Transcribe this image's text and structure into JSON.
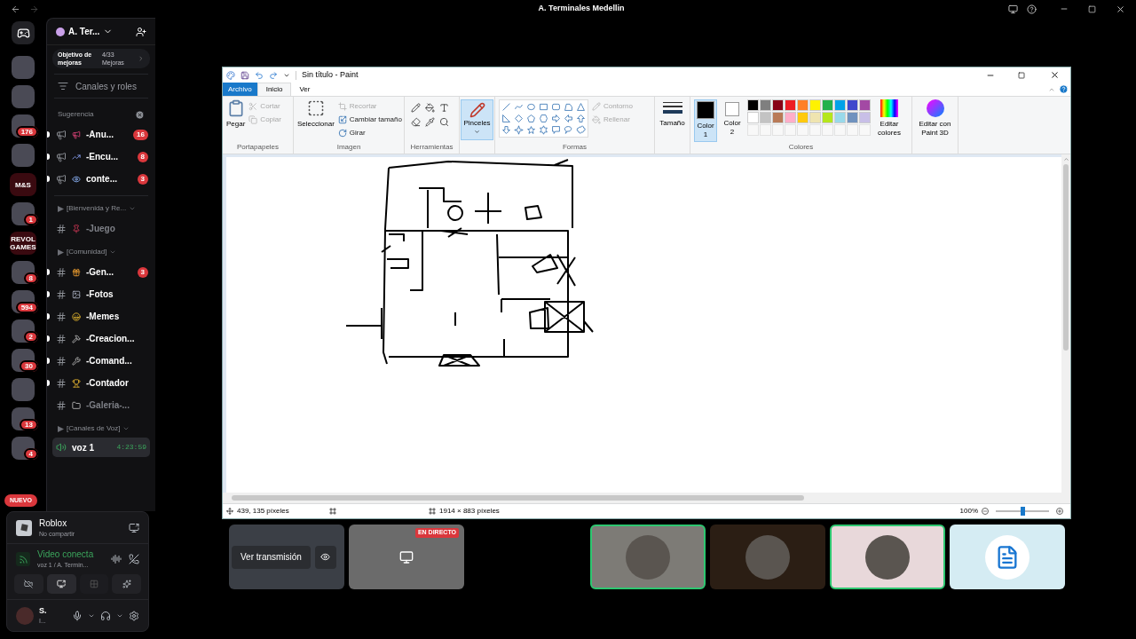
{
  "window": {
    "title": "A. Terminales Medellin"
  },
  "servers": [
    {
      "kind": "home"
    },
    {
      "kind": "icon"
    },
    {
      "kind": "icon"
    },
    {
      "kind": "icon",
      "badge": "176"
    },
    {
      "kind": "icon"
    },
    {
      "kind": "text",
      "label": "M&S"
    },
    {
      "kind": "icon",
      "badge": "1"
    },
    {
      "kind": "text",
      "label": "REVOL GAMES"
    },
    {
      "kind": "icon",
      "badge": "8"
    },
    {
      "kind": "icon",
      "badge": "594"
    },
    {
      "kind": "icon",
      "badge": "2"
    },
    {
      "kind": "icon",
      "badge": "30"
    },
    {
      "kind": "icon"
    },
    {
      "kind": "icon",
      "badge": "13"
    },
    {
      "kind": "icon",
      "badge": "4"
    }
  ],
  "new_badge": "NUEVO",
  "server": {
    "name": "A. Ter...",
    "boost_goal": "Objetivo de mejoras",
    "boost_count": "4/33 Mejoras",
    "browse": "Canales y roles"
  },
  "categories": [
    {
      "name": "Sugerencia",
      "kind": "suggestion",
      "channels": [
        {
          "kind": "announcement",
          "name": "-Anu...",
          "unread": true,
          "badge": "16"
        },
        {
          "kind": "announcement",
          "name": "-Encu...",
          "unread": true,
          "badge": "8"
        },
        {
          "kind": "announcement",
          "name": "conte...",
          "unread": true,
          "badge": "3"
        }
      ]
    },
    {
      "name": "[Bienvenida y Re...",
      "kind": "folder",
      "channels": [
        {
          "kind": "text",
          "name": "-Juego",
          "unread": false
        }
      ]
    },
    {
      "name": "[Comunidad]",
      "kind": "folder",
      "channels": [
        {
          "kind": "text",
          "name": "-Gen...",
          "unread": true,
          "badge": "3"
        },
        {
          "kind": "text",
          "name": "-Fotos",
          "unread": true
        },
        {
          "kind": "text",
          "name": "-Memes",
          "unread": true
        },
        {
          "kind": "text",
          "name": "-Creacion...",
          "unread": true
        },
        {
          "kind": "text",
          "name": "-Comand...",
          "unread": true
        },
        {
          "kind": "text",
          "name": "-Contador",
          "unread": true
        },
        {
          "kind": "text",
          "name": "-Galeria-...",
          "unread": false
        }
      ]
    },
    {
      "name": "[Canales de Voz]",
      "kind": "folder",
      "channels": [
        {
          "kind": "voice",
          "name": "voz 1",
          "time": "4:23:59",
          "selected": true
        }
      ]
    }
  ],
  "activity": {
    "game": "Roblox",
    "status": "No compartir"
  },
  "voice_panel": {
    "status": "Video conecta",
    "channel": "voz 1 / A. Termin..."
  },
  "user": {
    "name": "S.",
    "status": "I..."
  },
  "paint": {
    "title": "Sin título - Paint",
    "tabs": [
      {
        "label": "Archivo",
        "kind": "file",
        "selected": false
      },
      {
        "label": "Inicio",
        "kind": "tab",
        "selected": true
      },
      {
        "label": "Ver",
        "kind": "tab",
        "selected": false
      }
    ],
    "clipboard": {
      "label": "Portapapeles",
      "paste": "Pegar",
      "cut": {
        "label": "Cortar",
        "disabled": true
      },
      "copy": {
        "label": "Copiar",
        "disabled": true
      }
    },
    "image": {
      "label": "Imagen",
      "select": "Seleccionar",
      "crop": {
        "label": "Recortar",
        "disabled": true
      },
      "resize": {
        "label": "Cambiar tamaño",
        "disabled": false
      },
      "rotate": {
        "label": "Girar",
        "disabled": false
      }
    },
    "tools": {
      "label": "Herramientas"
    },
    "brushes": {
      "label": "Pinceles",
      "selected": true
    },
    "shapes": {
      "label": "Formas",
      "outline": {
        "label": "Contorno",
        "disabled": true
      },
      "fill": {
        "label": "Rellenar",
        "disabled": true
      }
    },
    "size": {
      "label": "Tamaño"
    },
    "color1": {
      "label": "Color 1",
      "color": "#000000",
      "selected": true
    },
    "color2": {
      "label": "Color 2",
      "color": "#ffffff",
      "selected": false
    },
    "colors": {
      "label": "Colores",
      "palette": [
        {
          "color": "#000000"
        },
        {
          "color": "#7f7f7f"
        },
        {
          "color": "#880015"
        },
        {
          "color": "#ed1c24"
        },
        {
          "color": "#ff7f27"
        },
        {
          "color": "#fff200"
        },
        {
          "color": "#22b14c"
        },
        {
          "color": "#00a2e8"
        },
        {
          "color": "#3f48cc"
        },
        {
          "color": "#a349a4"
        },
        {
          "color": "#ffffff"
        },
        {
          "color": "#c3c3c3"
        },
        {
          "color": "#b97a57"
        },
        {
          "color": "#ffaec9"
        },
        {
          "color": "#ffc90e"
        },
        {
          "color": "#efe4b0"
        },
        {
          "color": "#b5e61d"
        },
        {
          "color": "#99d9ea"
        },
        {
          "color": "#7092be"
        },
        {
          "color": "#c8bfe7"
        }
      ]
    },
    "edit_colors": "Editar colores",
    "paint3d": "Editar con Paint 3D",
    "status": {
      "cursor": "439, 135 píxeles",
      "size": "1914 × 883 píxeles",
      "zoom": "100%",
      "level": 0.5
    }
  },
  "stream": {
    "watch": "Ver transmisión",
    "live": "EN DIRECTO"
  },
  "participants": [
    {
      "kind": "avatar",
      "speaking": true,
      "color": "#7d7b76"
    },
    {
      "kind": "avatar",
      "speaking": false,
      "color": "#2b1e14"
    },
    {
      "kind": "avatar",
      "speaking": true,
      "color": "#e8d8da"
    },
    {
      "kind": "audio",
      "speaking": false,
      "color": "#d5ecf3"
    }
  ]
}
